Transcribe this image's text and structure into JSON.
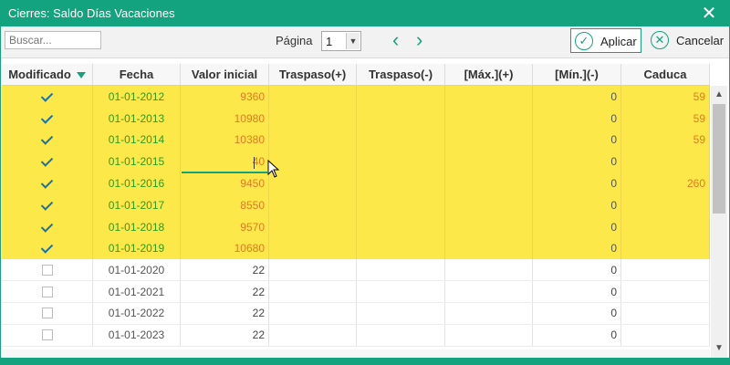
{
  "window": {
    "title": "Cierres: Saldo Días Vacaciones",
    "close_glyph": "✕"
  },
  "toolbar": {
    "search_placeholder": "Buscar...",
    "page_label": "Página",
    "page_value": "1",
    "apply_label": "Aplicar",
    "cancel_label": "Cancelar",
    "apply_icon": "check-circle-icon",
    "cancel_icon": "x-circle-icon"
  },
  "columns": [
    "Modificado",
    "Fecha",
    "Valor inicial",
    "Traspaso(+)",
    "Traspaso(-)",
    "[Máx.](+)",
    "[Mín.](-)",
    "Caduca"
  ],
  "rows": [
    {
      "checked": true,
      "date": "01-01-2012",
      "valor_inicial": "9360",
      "traspaso_pos": "",
      "traspaso_neg": "",
      "max": "",
      "min": "0",
      "caduca": "59"
    },
    {
      "checked": true,
      "date": "01-01-2013",
      "valor_inicial": "10980",
      "traspaso_pos": "",
      "traspaso_neg": "",
      "max": "",
      "min": "0",
      "caduca": "59"
    },
    {
      "checked": true,
      "date": "01-01-2014",
      "valor_inicial": "10380",
      "traspaso_pos": "",
      "traspaso_neg": "",
      "max": "",
      "min": "0",
      "caduca": "59"
    },
    {
      "checked": true,
      "date": "01-01-2015",
      "valor_inicial": "40",
      "traspaso_pos": "",
      "traspaso_neg": "",
      "max": "",
      "min": "0",
      "caduca": ""
    },
    {
      "checked": true,
      "date": "01-01-2016",
      "valor_inicial": "9450",
      "traspaso_pos": "",
      "traspaso_neg": "",
      "max": "",
      "min": "0",
      "caduca": "260"
    },
    {
      "checked": true,
      "date": "01-01-2017",
      "valor_inicial": "8550",
      "traspaso_pos": "",
      "traspaso_neg": "",
      "max": "",
      "min": "0",
      "caduca": ""
    },
    {
      "checked": true,
      "date": "01-01-2018",
      "valor_inicial": "9570",
      "traspaso_pos": "",
      "traspaso_neg": "",
      "max": "",
      "min": "0",
      "caduca": ""
    },
    {
      "checked": true,
      "date": "01-01-2019",
      "valor_inicial": "10680",
      "traspaso_pos": "",
      "traspaso_neg": "",
      "max": "",
      "min": "0",
      "caduca": ""
    },
    {
      "checked": false,
      "date": "01-01-2020",
      "valor_inicial": "22",
      "traspaso_pos": "",
      "traspaso_neg": "",
      "max": "",
      "min": "0",
      "caduca": ""
    },
    {
      "checked": false,
      "date": "01-01-2021",
      "valor_inicial": "22",
      "traspaso_pos": "",
      "traspaso_neg": "",
      "max": "",
      "min": "0",
      "caduca": ""
    },
    {
      "checked": false,
      "date": "01-01-2022",
      "valor_inicial": "22",
      "traspaso_pos": "",
      "traspaso_neg": "",
      "max": "",
      "min": "0",
      "caduca": ""
    },
    {
      "checked": false,
      "date": "01-01-2023",
      "valor_inicial": "22",
      "traspaso_pos": "",
      "traspaso_neg": "",
      "max": "",
      "min": "0",
      "caduca": ""
    }
  ],
  "colors": {
    "accent": "#14a37f",
    "modified_row": "#fde84a",
    "modified_date": "#2e9a1f",
    "modified_value": "#e07b20"
  }
}
